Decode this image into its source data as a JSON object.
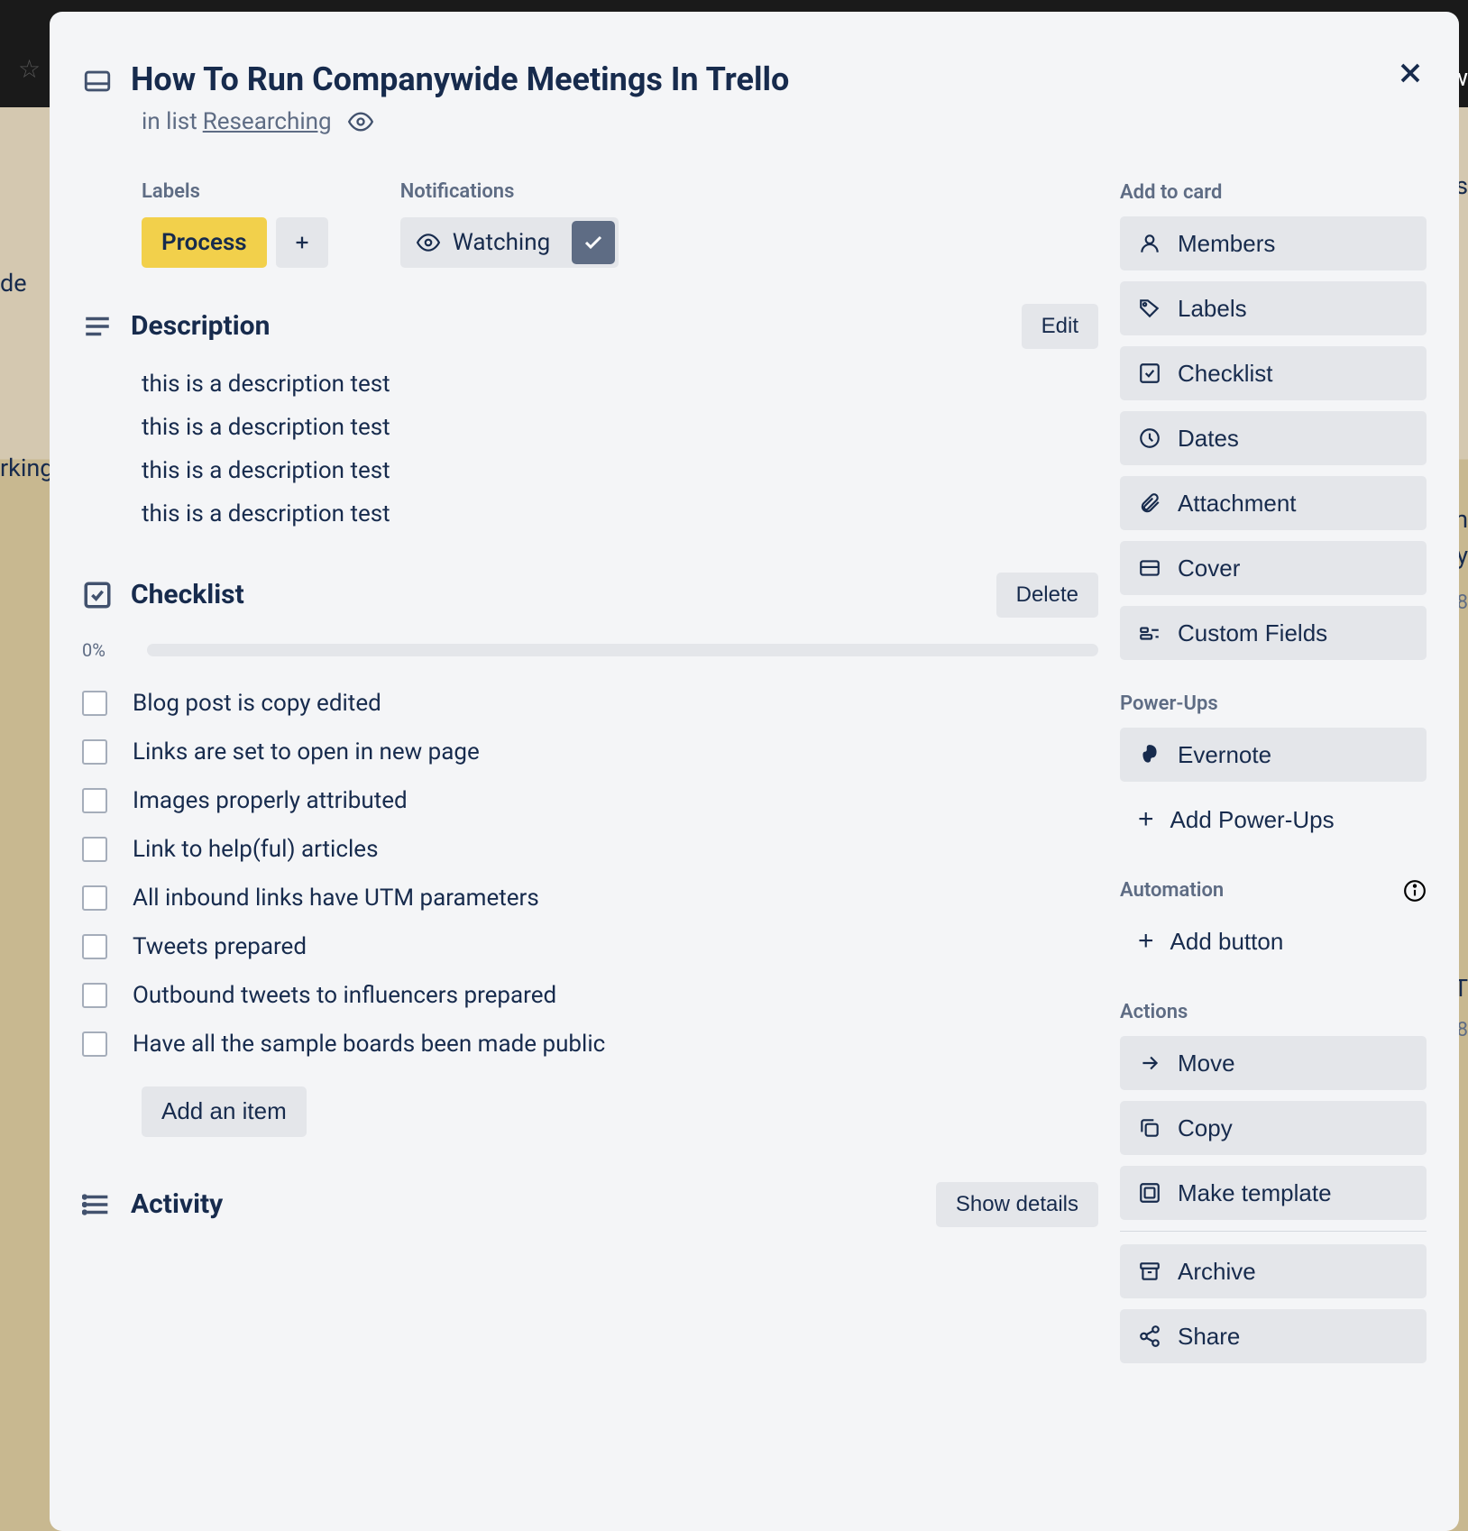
{
  "bg": {
    "de_text": "de",
    "rking": "rking",
    "ow": "ow",
    "s": "s",
    "nm": "nm",
    "y": "y",
    "eight": "8",
    "urt": "ur T",
    "eight2": "8"
  },
  "header": {
    "title": "How To Run Companywide Meetings In Trello",
    "in_list_prefix": "in list ",
    "list_name": "Researching"
  },
  "labels": {
    "heading": "Labels",
    "items": [
      "Process"
    ]
  },
  "notifications": {
    "heading": "Notifications",
    "watching": "Watching"
  },
  "description": {
    "heading": "Description",
    "edit": "Edit",
    "lines": [
      "this is a description test",
      "this is a description test",
      "this is a description test",
      "this is a description test"
    ]
  },
  "checklist": {
    "heading": "Checklist",
    "delete": "Delete",
    "progress": "0%",
    "items": [
      "Blog post is copy edited",
      "Links are set to open in new page",
      "Images properly attributed",
      "Link to help(ful) articles",
      "All inbound links have UTM parameters",
      "Tweets prepared",
      "Outbound tweets to influencers prepared",
      "Have all the sample boards been made public"
    ],
    "add_item": "Add an item"
  },
  "activity": {
    "heading": "Activity",
    "show_details": "Show details"
  },
  "sidebar": {
    "add_to_card": {
      "heading": "Add to card",
      "items": [
        "Members",
        "Labels",
        "Checklist",
        "Dates",
        "Attachment",
        "Cover",
        "Custom Fields"
      ]
    },
    "powerups": {
      "heading": "Power-Ups",
      "evernote": "Evernote",
      "add": "Add Power-Ups"
    },
    "automation": {
      "heading": "Automation",
      "add_button": "Add button"
    },
    "actions": {
      "heading": "Actions",
      "items": [
        "Move",
        "Copy",
        "Make template",
        "Archive",
        "Share"
      ]
    }
  }
}
